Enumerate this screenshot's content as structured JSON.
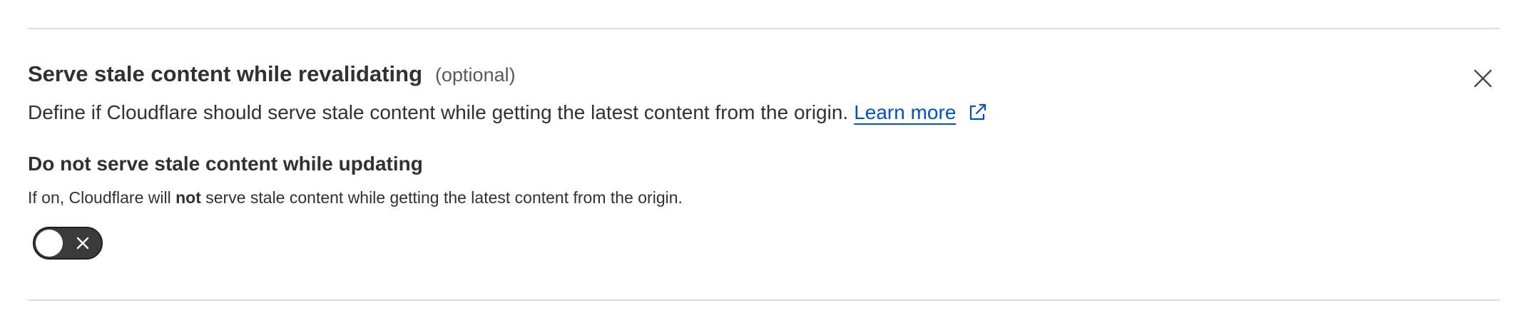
{
  "section": {
    "title": "Serve stale content while revalidating",
    "optional_label": "(optional)",
    "description": "Define if Cloudflare should serve stale content while getting the latest content from the origin.",
    "learn_more": "Learn more",
    "close_icon": "close-icon",
    "external_link_icon": "external-link-icon"
  },
  "setting": {
    "title": "Do not serve stale content while updating",
    "description_prefix": "If on, Cloudflare will ",
    "description_bold": "not",
    "description_suffix": " serve stale content while getting the latest content from the origin.",
    "toggle_state": "off"
  },
  "colors": {
    "link": "#0051c3",
    "toggle_off_bg": "#3b3b3b",
    "text": "#313131",
    "divider": "#dedede"
  }
}
